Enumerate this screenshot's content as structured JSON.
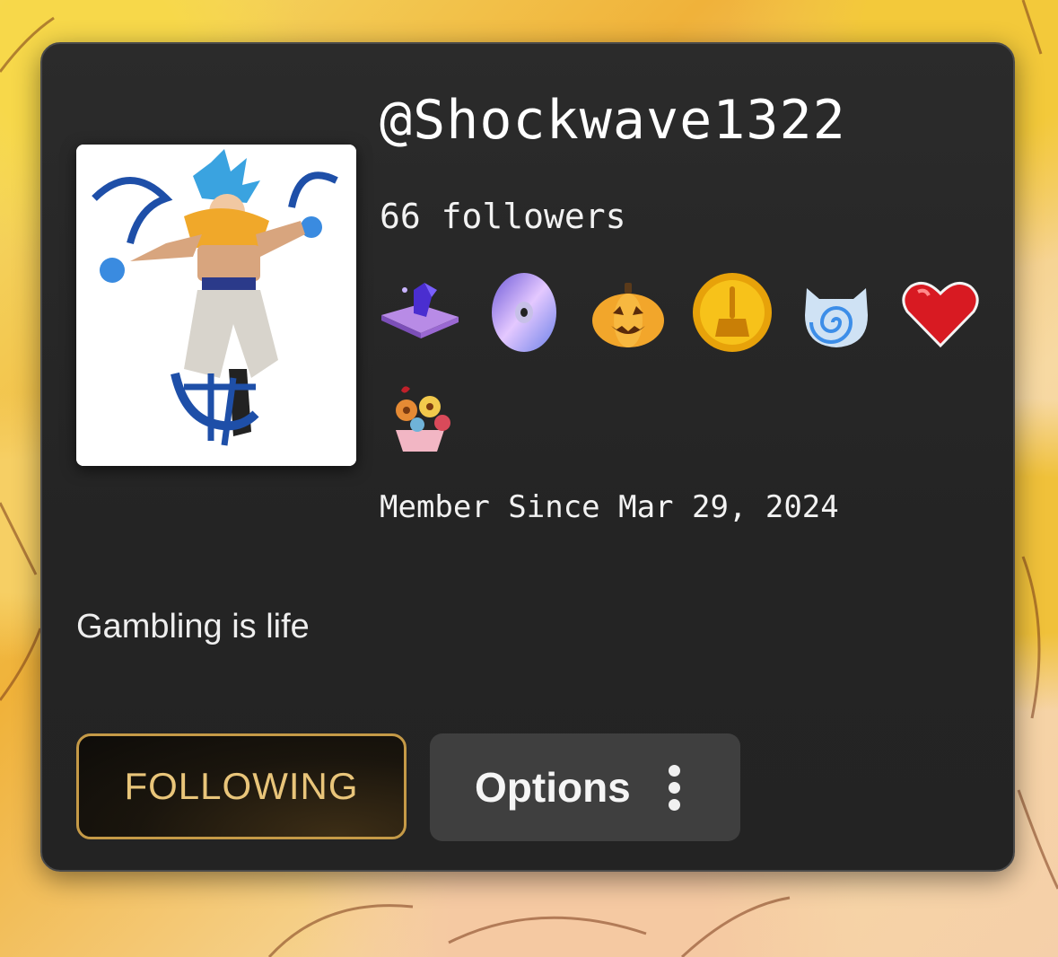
{
  "profile": {
    "username": "@Shockwave1322",
    "followers": "66 followers",
    "member_since": "Member Since Mar 29, 2024",
    "bio": "Gambling is life"
  },
  "badges": [
    {
      "icon": "magic-book-crystal-icon"
    },
    {
      "icon": "cd-disc-icon"
    },
    {
      "icon": "jack-o-lantern-icon"
    },
    {
      "icon": "gold-broom-coin-icon"
    },
    {
      "icon": "blue-spiral-cat-icon"
    },
    {
      "icon": "red-heart-icon"
    },
    {
      "icon": "flower-bouquet-icon"
    }
  ],
  "actions": {
    "following_label": "FOLLOWING",
    "options_label": "Options"
  },
  "colors": {
    "card_bg": "#262626",
    "following_border": "#c59a47",
    "following_text": "#e9c57a",
    "options_bg": "#3f3f3f"
  }
}
